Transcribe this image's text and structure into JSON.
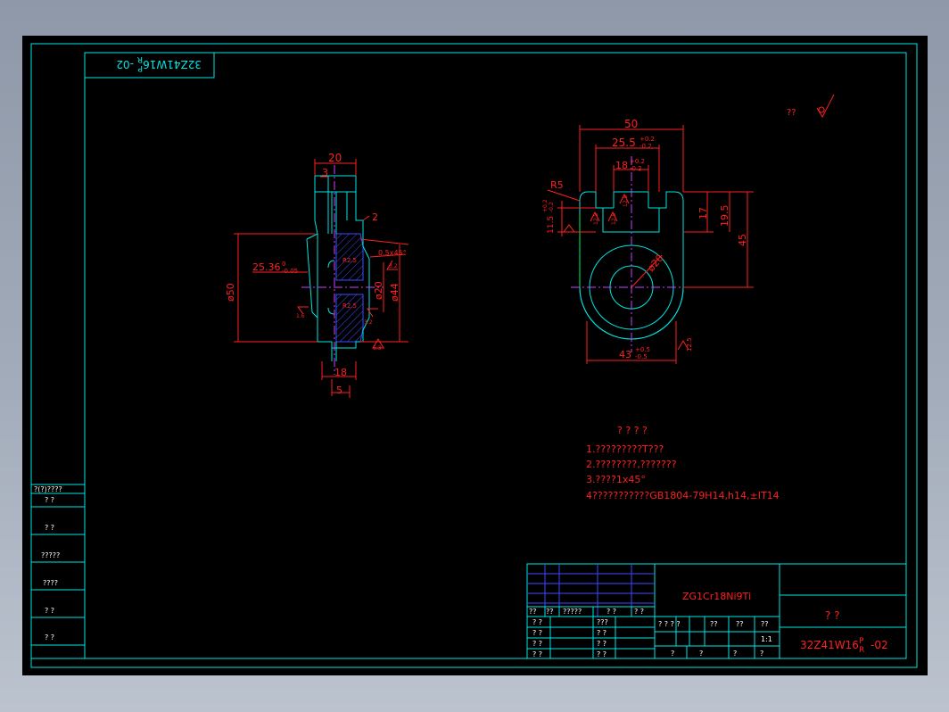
{
  "colors": {
    "background": "#000000",
    "frame": "#00e5e5",
    "dimension": "#ff2020",
    "hatch": "#3b4cff",
    "center": "#d040ff",
    "part": "#00e5e5"
  },
  "title_block": {
    "material": "ZG1Cr18Ni9Ti",
    "drawing_number": "32Z41W16",
    "suffix_top": "P",
    "suffix_bottom": "R",
    "suffix_tail": "-02",
    "name": "?   ?",
    "scale": "1:1",
    "row_header": [
      "??",
      "??",
      "?????",
      "? ?",
      "? ?"
    ],
    "label_row": [
      "? ? ? ?",
      "??",
      "??",
      "??"
    ],
    "left_cells": [
      [
        "? ?",
        "???"
      ],
      [
        "? ?",
        "? ?"
      ],
      [
        "? ?",
        "? ?"
      ],
      [
        "? ?",
        "? ?"
      ]
    ],
    "bottom_row": [
      "?",
      "?",
      "?",
      "?"
    ]
  },
  "top_tab": {
    "number": "32Z41W16",
    "suffix_top": "P",
    "suffix_bottom": "R",
    "suffix_tail": "-02"
  },
  "side_table": [
    "?(?)????",
    "?   ?",
    "?   ?",
    "?????",
    "????",
    "?   ?",
    "?   ?"
  ],
  "roughness_note": "??",
  "notes": {
    "heading": "?  ?  ?  ?",
    "lines": [
      "1.?????????T???",
      "2.????????,???????",
      "3.????1x45°",
      "4???????????GB1804-79H14,h14,±IT14"
    ]
  },
  "section_view": {
    "dims": {
      "top_width": "20",
      "step": "3",
      "chamfer": "2",
      "diameter_outer": "ø50",
      "taper": "25.36",
      "taper_tol_top": "0",
      "taper_tol_bottom": "-0.05",
      "bore": "ø20",
      "boss": "ø44",
      "chamfer_note": "0.5x45°",
      "width_bottom": "18",
      "offset": "5",
      "r_top": "R2.5",
      "r_bottom": "R2.5",
      "roughness_1": "1.6",
      "roughness_2": "3.2",
      "roughness_3": "6.3",
      "roughness_4": "3.2"
    }
  },
  "front_view": {
    "dims": {
      "width": "50",
      "slot": "25.5",
      "slot_tol_top": "+0.2",
      "slot_tol_bottom": "-0.2",
      "slot_inner": "18",
      "slot_inner_tol_top": "+0.2",
      "slot_inner_tol_bottom": "-0.2",
      "radius": "R5",
      "offset": "11.5",
      "offset_tol_top": "+0.2",
      "offset_tol_bottom": "-0.2",
      "height_17": "17",
      "height_19": "19.5",
      "height_45": "45",
      "bore": "ø20",
      "bottom": "43",
      "bottom_tol_top": "+0.5",
      "bottom_tol_bottom": "-0.5",
      "roughness_a": "12.5",
      "roughness_b": "12.5",
      "roughness_c": "12.5",
      "roughness_d": "12.5"
    }
  }
}
